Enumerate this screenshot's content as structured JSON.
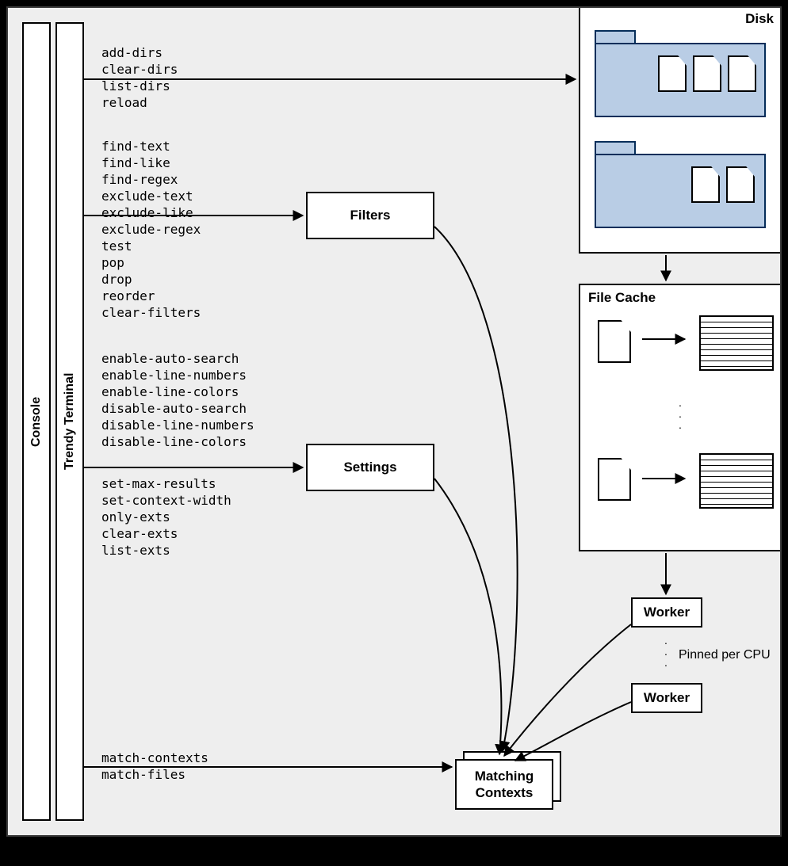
{
  "console_label": "Console",
  "terminal_label": "Trendy Terminal",
  "groups": {
    "disk_cmds": "add-dirs\nclear-dirs\nlist-dirs\nreload",
    "filter_cmds": "find-text\nfind-like\nfind-regex\nexclude-text\nexclude-like\nexclude-regex\ntest\npop\ndrop\nreorder\nclear-filters",
    "settings_cmds_top": "enable-auto-search\nenable-line-numbers\nenable-line-colors\ndisable-auto-search\ndisable-line-numbers\ndisable-line-colors",
    "settings_cmds_bot": "set-max-results\nset-context-width\nonly-exts\nclear-exts\nlist-exts",
    "match_cmds": "match-contexts\nmatch-files"
  },
  "boxes": {
    "filters": "Filters",
    "settings": "Settings",
    "disk": "Disk",
    "filecache": "File Cache",
    "worker1": "Worker",
    "worker2": "Worker",
    "matching": "Matching\nContexts"
  },
  "annotations": {
    "pinned": "Pinned per CPU"
  }
}
